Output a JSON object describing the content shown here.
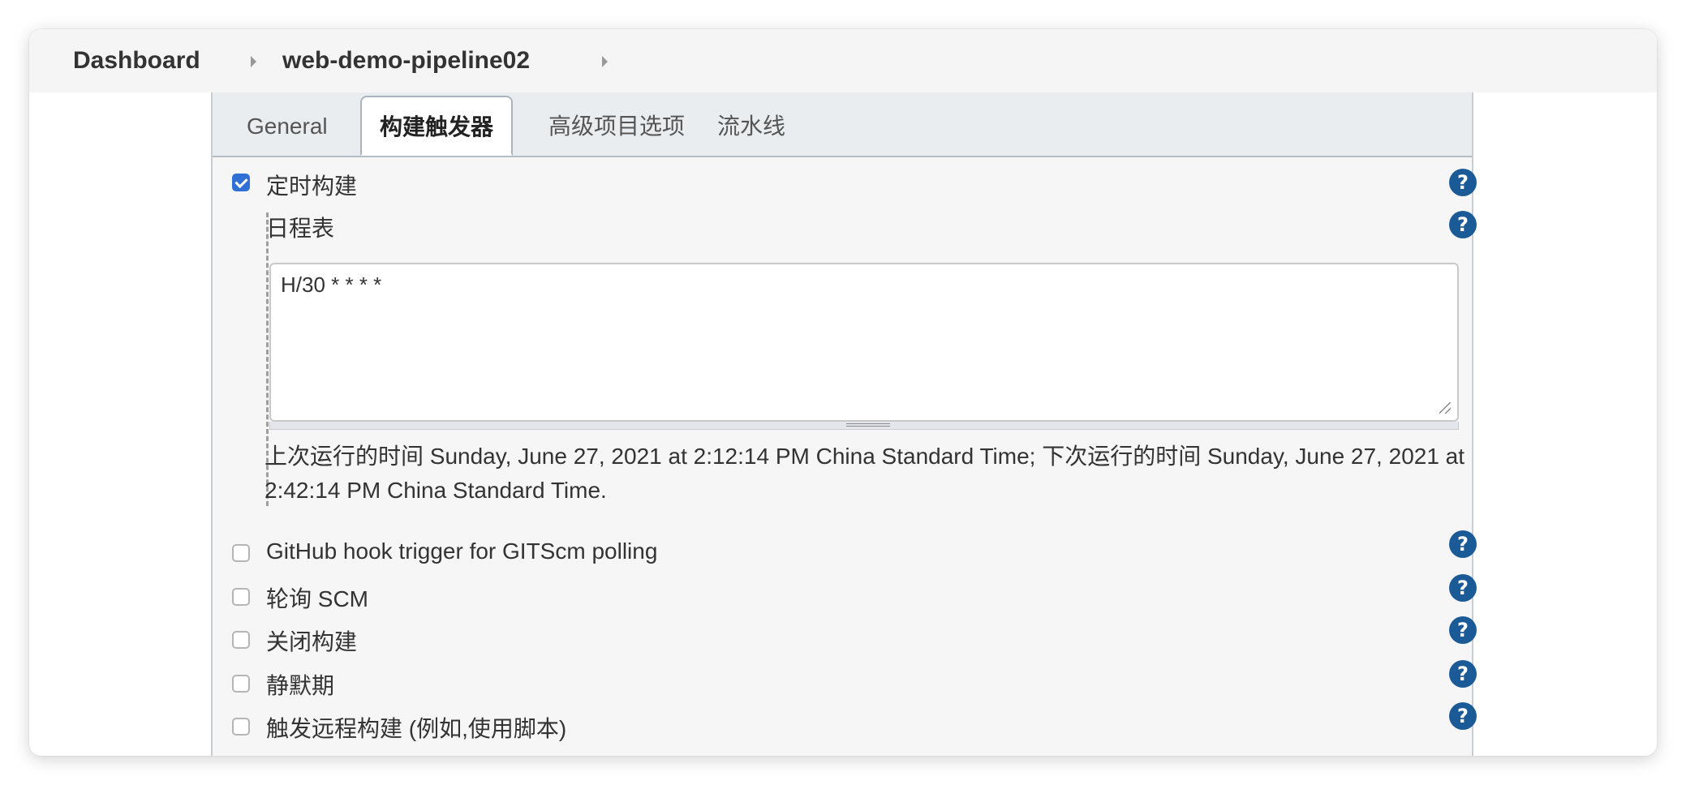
{
  "breadcrumb": {
    "items": [
      "Dashboard",
      "web-demo-pipeline02"
    ]
  },
  "tabs": [
    {
      "label": "General",
      "active": false
    },
    {
      "label": "构建触发器",
      "active": true
    },
    {
      "label": "高级项目选项",
      "active": false
    },
    {
      "label": "流水线",
      "active": false
    }
  ],
  "triggers": {
    "timed_build": {
      "label": "定时构建",
      "checked": true
    },
    "schedule": {
      "label": "日程表",
      "value": "H/30 * * * *",
      "info": "上次运行的时间 Sunday, June 27, 2021 at 2:12:14 PM China Standard Time; 下次运行的时间 Sunday, June 27, 2021 at 2:42:14 PM China Standard Time."
    },
    "options": [
      {
        "label": "GitHub hook trigger for GITScm polling",
        "checked": false
      },
      {
        "label": "轮询 SCM",
        "checked": false
      },
      {
        "label": "关闭构建",
        "checked": false
      },
      {
        "label": "静默期",
        "checked": false
      },
      {
        "label": "触发远程构建 (例如,使用脚本)",
        "checked": false
      }
    ]
  },
  "help_glyph": "?",
  "colors": {
    "checkbox_checked": "#2f6fd6",
    "help_icon": "#1a5a96",
    "tab_bar": "#e9edf0",
    "panel_bg": "#f6f6f6"
  }
}
